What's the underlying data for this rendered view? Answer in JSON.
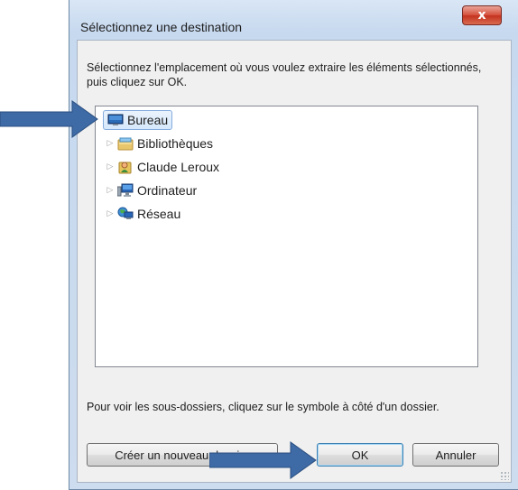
{
  "dialog": {
    "title": "Sélectionnez une destination",
    "close_symbol": "x",
    "instruction": "Sélectionnez l'emplacement où vous voulez extraire les éléments sélectionnés, puis cliquez sur OK.",
    "hint": "Pour voir les sous-dossiers, cliquez sur le symbole à côté d'un dossier."
  },
  "tree": {
    "items": [
      {
        "label": "Bureau",
        "icon": "desktop-icon",
        "selected": true,
        "expander": ""
      },
      {
        "label": "Bibliothèques",
        "icon": "libraries-icon",
        "selected": false,
        "expander": "▷"
      },
      {
        "label": "Claude Leroux",
        "icon": "user-folder-icon",
        "selected": false,
        "expander": "▷"
      },
      {
        "label": "Ordinateur",
        "icon": "computer-icon",
        "selected": false,
        "expander": "▷"
      },
      {
        "label": "Réseau",
        "icon": "network-icon",
        "selected": false,
        "expander": "▷"
      }
    ]
  },
  "buttons": {
    "new_folder": "Créer un nouveau dossier",
    "ok": "OK",
    "cancel": "Annuler"
  },
  "annotations": {
    "arrow_color": "#3e6aa6"
  }
}
